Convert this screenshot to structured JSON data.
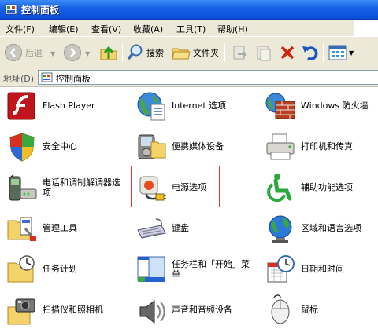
{
  "window": {
    "title": "控制面板",
    "icon": "control-panel-icon"
  },
  "menu": [
    "文件(F)",
    "编辑(E)",
    "查看(V)",
    "收藏(A)",
    "工具(T)",
    "帮助(H)"
  ],
  "toolbar": {
    "back_label": "后退",
    "search_label": "搜索",
    "folders_label": "文件夹"
  },
  "address": {
    "label": "地址(D)",
    "value": "控制面板"
  },
  "items": [
    {
      "label": "Flash Player",
      "icon": "flash-icon"
    },
    {
      "label": "Internet 选项",
      "icon": "globe-document-icon"
    },
    {
      "label": "Windows 防火墙",
      "icon": "firewall-icon"
    },
    {
      "label": "安全中心",
      "icon": "shield-icon"
    },
    {
      "label": "便携媒体设备",
      "icon": "media-device-icon"
    },
    {
      "label": "打印机和传真",
      "icon": "printer-icon"
    },
    {
      "label": "电话和调制解调器选项",
      "icon": "phone-icon"
    },
    {
      "label": "电源选项",
      "icon": "power-plug-icon"
    },
    {
      "label": "辅助功能选项",
      "icon": "accessibility-icon"
    },
    {
      "label": "管理工具",
      "icon": "admin-tools-icon"
    },
    {
      "label": "键盘",
      "icon": "keyboard-icon"
    },
    {
      "label": "区域和语言选项",
      "icon": "globe-icon"
    },
    {
      "label": "任务计划",
      "icon": "scheduled-tasks-icon"
    },
    {
      "label": "任务栏和「开始」菜单",
      "icon": "taskbar-icon"
    },
    {
      "label": "日期和时间",
      "icon": "calendar-clock-icon"
    },
    {
      "label": "扫描仪和照相机",
      "icon": "scanner-camera-icon"
    },
    {
      "label": "声音和音频设备",
      "icon": "speaker-icon"
    },
    {
      "label": "鼠标",
      "icon": "mouse-icon"
    }
  ],
  "colors": {
    "titlebar": "#1660e8",
    "chrome": "#ece9d8",
    "highlight_border": "#c84040"
  }
}
